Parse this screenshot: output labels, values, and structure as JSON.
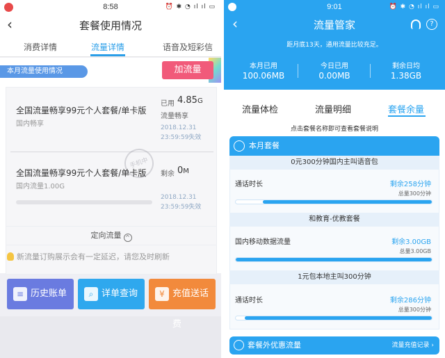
{
  "left": {
    "status": {
      "time": "8:58",
      "sys": "⏰ ✱ ◔ ıl ıl ▭"
    },
    "header": {
      "back_icon": "‹",
      "title": "套餐使用情况"
    },
    "tabs": [
      {
        "label": "消费详情"
      },
      {
        "label": "流量详情",
        "active": true
      },
      {
        "label": "语音及短彩信"
      }
    ],
    "usage_label": "本月流量使用情况",
    "add_button": "加流量",
    "packages": [
      {
        "name": "全国流量畅享99元个人套餐/单卡版",
        "sub": "国内畅享",
        "used_label": "已用",
        "used_value": "4.85",
        "used_unit": "G",
        "state": "流量畅享",
        "date1": "2018.12.31",
        "date2": "23:59:59失效"
      },
      {
        "name": "全国流量畅享99元个人套餐/单卡版",
        "sub": "国内流量1.00G",
        "used_label": "剩余",
        "used_value": "0",
        "used_unit": "M",
        "date1": "2018.12.31",
        "date2": "23:59:59失效"
      }
    ],
    "watermark": "手机中",
    "directed": {
      "label": "定向流量",
      "chevron": "^"
    },
    "notice": "新流量订购展示会有一定延迟，请您及时刷新",
    "buttons": [
      {
        "label": "历史账单",
        "icon": "bill-icon",
        "glyph": "≡",
        "color": "#6a7be0"
      },
      {
        "label": "详单查询",
        "icon": "search-icon",
        "glyph": "⌕",
        "color": "#2fa8ee"
      },
      {
        "label": "充值送话费",
        "icon": "recharge-icon",
        "glyph": "¥",
        "color": "#f28a3c"
      }
    ]
  },
  "right": {
    "status": {
      "time": "9:01",
      "sys": "⏰ ✱ ◔ ıl ıl ▭"
    },
    "header": {
      "back_icon": "‹",
      "title": "流量管家",
      "help_icon": "?"
    },
    "subtitle": "距月底13天，通用流量比较充足。",
    "stats": [
      {
        "label": "本月已用",
        "value": "100.06MB"
      },
      {
        "label": "今日已用",
        "value": "0.00MB"
      },
      {
        "label": "剩余日均",
        "value": "1.38GB"
      }
    ],
    "tabs": [
      {
        "label": "流量体检"
      },
      {
        "label": "流量明细"
      },
      {
        "label": "套餐余量",
        "active": true
      }
    ],
    "hint": "点击套餐名称即可查看套餐说明",
    "card_title": "本月套餐",
    "sections": [
      {
        "title": "0元300分钟国内主叫语音包",
        "item": "通话时长",
        "remain": "剩余258分钟",
        "total": "总量300分钟",
        "ratio": 0.86
      },
      {
        "title": "和教育-优教套餐",
        "item": "国内移动数据流量",
        "remain": "剩余3.00GB",
        "total": "总量3.00GB",
        "ratio": 1.0
      },
      {
        "title": "1元包本地主叫300分钟",
        "item": "通话时长",
        "remain": "剩余286分钟",
        "total": "总量300分钟",
        "ratio": 0.953
      }
    ],
    "footer": {
      "title": "套餐外优惠流量",
      "link": "流量充值记录 ›"
    }
  }
}
